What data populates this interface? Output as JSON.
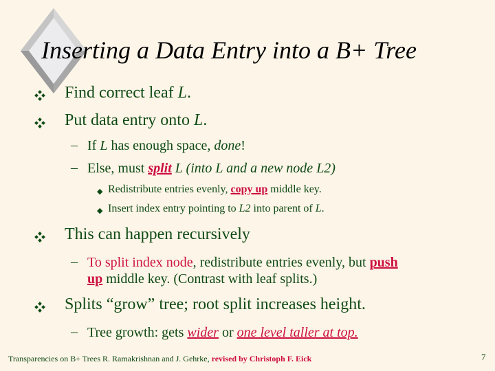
{
  "slide": {
    "title": "Inserting a Data Entry into a B+ Tree",
    "colors": {
      "background": "#fdf5e8",
      "text": "#0f4a14",
      "accent": "#cc1040"
    },
    "bullets": [
      {
        "text_pre": "Find correct leaf ",
        "text_italic": "L",
        "text_post": "."
      },
      {
        "text_pre": "Put data entry onto ",
        "text_italic": "L",
        "text_post": "."
      }
    ],
    "sub1": {
      "a_pre": "If ",
      "a_it1": "L",
      "a_mid": " has enough space, ",
      "a_it2": "done",
      "a_post": "!",
      "b_pre": "Else, must ",
      "b_split": "split",
      "b_post": "  L (into L and a new node L2)"
    },
    "sub2": {
      "a_pre": "Redistribute entries evenly, ",
      "a_copyup": "copy up",
      "a_post": " middle key.",
      "b_pre": "Insert index entry pointing to ",
      "b_it1": "L2",
      "b_mid": " into parent of ",
      "b_it2": "L",
      "b_post": "."
    },
    "bullet3": "This can happen recursively",
    "sub3": {
      "red": "To split index node",
      "mid": ", redistribute entries evenly, but ",
      "push": "push",
      "up": "up",
      "post": " middle key.  (Contrast with leaf splits.)"
    },
    "bullet4": "Splits “grow” tree; root split increases height.",
    "sub4": {
      "pre": "Tree growth: gets ",
      "wider": "wider",
      "or": " or ",
      "taller": "one level taller at top."
    },
    "footer": {
      "authors": "Transparencies on B+ Trees R. Ramakrishnan and J. Gehrke, ",
      "revised": "revised by Christoph F. Eick"
    },
    "page_number": "7",
    "bullet_glyph_l2": "–",
    "bullet_glyph_l3": "◆"
  }
}
